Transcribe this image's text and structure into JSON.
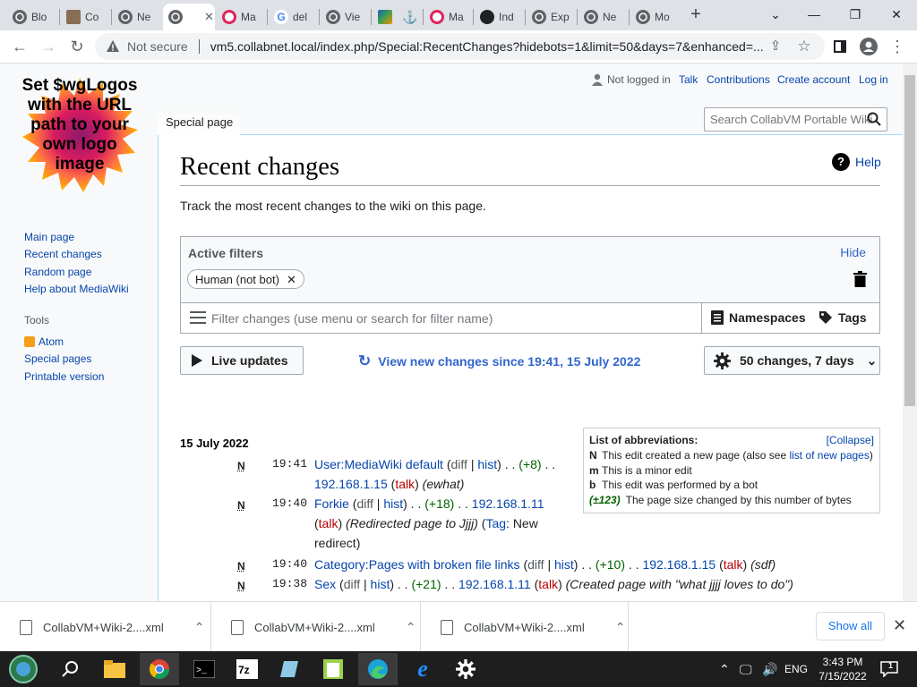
{
  "browser": {
    "tabs": [
      {
        "title": "Blo",
        "icon": "globe-icon"
      },
      {
        "title": "Co",
        "icon": "avatar-icon"
      },
      {
        "title": "Ne",
        "icon": "globe-icon"
      },
      {
        "title": "",
        "icon": "globe-icon",
        "active": true
      },
      {
        "title": "Ma",
        "icon": "opera-icon"
      },
      {
        "title": "del",
        "icon": "google-icon"
      },
      {
        "title": "Vie",
        "icon": "globe-icon"
      },
      {
        "title": "",
        "icon": "colorful-icon"
      },
      {
        "title": "",
        "icon": "anchor-icon"
      },
      {
        "title": "Ma",
        "icon": "opera-icon"
      },
      {
        "title": "Ind",
        "icon": "shield-icon"
      },
      {
        "title": "Exp",
        "icon": "globe-icon"
      },
      {
        "title": "Ne",
        "icon": "globe-icon"
      },
      {
        "title": "Mo",
        "icon": "globe-icon"
      }
    ],
    "security_label": "Not secure",
    "url": "vm5.collabnet.local/index.php/Special:RecentChanges?hidebots=1&limit=50&days=7&enhanced=..."
  },
  "wiki": {
    "logo_text": "Set $wgLogos with the URL path to your own logo image",
    "sidebar": {
      "nav": [
        "Main page",
        "Recent changes",
        "Random page",
        "Help about MediaWiki"
      ],
      "tools_heading": "Tools",
      "tools": [
        "Atom",
        "Special pages",
        "Printable version"
      ]
    },
    "personal": {
      "status": "Not logged in",
      "links": [
        "Talk",
        "Contributions",
        "Create account",
        "Log in"
      ]
    },
    "special_tab": "Special page",
    "search_placeholder": "Search CollabVM Portable Wiki",
    "heading": "Recent changes",
    "help": "Help",
    "tagline": "Track the most recent changes to the wiki on this page.",
    "filters": {
      "title": "Active filters",
      "hide": "Hide",
      "chip": "Human (not bot)",
      "placeholder": "Filter changes (use menu or search for filter name)",
      "namespaces": "Namespaces",
      "tags": "Tags"
    },
    "live_updates": "Live updates",
    "view_new": "View new changes since 19:41, 15 July 2022",
    "changes_limit": "50 changes, 7 days",
    "abbreviations": {
      "title": "List of abbreviations:",
      "collapse": "[Collapse]",
      "items": [
        {
          "key": "N",
          "text": "This edit created a new page (also see ",
          "link": "list of new pages",
          "after": ")"
        },
        {
          "key": "m",
          "text": "This is a minor edit",
          "link": "",
          "after": ""
        },
        {
          "key": "b",
          "text": "This edit was performed by a bot",
          "link": "",
          "after": ""
        },
        {
          "key": "(±123)",
          "text": "The page size changed by this number of bytes",
          "link": "",
          "after": ""
        }
      ]
    },
    "date": "15 July 2022",
    "changes": [
      {
        "flag": "N",
        "time": "19:41",
        "page": "User:MediaWiki default",
        "diff": "diff",
        "hist": "hist",
        "size": "(+8)",
        "user": "192.168.1.15",
        "talk": "talk",
        "comment": "(ewhat)"
      },
      {
        "flag": "N",
        "time": "19:40",
        "page": "Forkie",
        "diff": "diff",
        "hist": "hist",
        "size": "(+18)",
        "user": "192.168.1.11",
        "talk": "talk",
        "comment": "(Redirected page to Jjjj)",
        "tag_label": "Tag",
        "tag_value": "New redirect"
      },
      {
        "flag": "N",
        "time": "19:40",
        "page": "Category:Pages with broken file links",
        "diff": "diff",
        "hist": "hist",
        "size": "(+10)",
        "user": "192.168.1.15",
        "talk": "talk",
        "comment": "(sdf)"
      },
      {
        "flag": "N",
        "time": "19:38",
        "page": "Sex",
        "diff": "diff",
        "hist": "hist",
        "size": "(+21)",
        "user": "192.168.1.11",
        "talk": "talk",
        "comment": "(Created page with \"what jjjj loves to do\")"
      }
    ]
  },
  "downloads": {
    "items": [
      "CollabVM+Wiki-2....xml",
      "CollabVM+Wiki-2....xml",
      "CollabVM+Wiki-2....xml"
    ],
    "show_all": "Show all"
  },
  "taskbar": {
    "language": "ENG",
    "time": "3:43 PM",
    "date": "7/15/2022",
    "notifications": "1"
  }
}
